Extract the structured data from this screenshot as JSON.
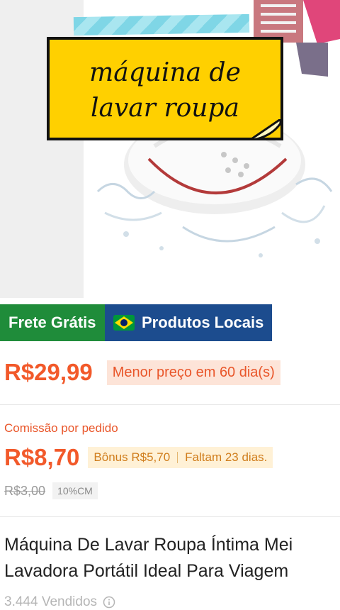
{
  "product_image": {
    "overlay_text": "máquina de lavar roupa",
    "tape_color": "#8fdbe8",
    "sticker_color": "#ffd000"
  },
  "badges": {
    "free_shipping": "Frete Grátis",
    "local_products": "Produtos Locais",
    "free_color": "#1f8c3a",
    "local_color": "#1c4c8e"
  },
  "price": {
    "current": "R$29,99",
    "lowest_badge": "Menor preço em 60 dia(s)"
  },
  "commission": {
    "label": "Comissão por pedido",
    "amount": "R$8,70",
    "bonus": "Bônus R$5,70",
    "remaining": "Faltam 23 dias.",
    "old_amount": "R$3,00",
    "rate": "10%CM"
  },
  "title": {
    "line1": "Máquina De Lavar Roupa Íntima Mei",
    "line2": "Lavadora Portátil Ideal Para Viagem"
  },
  "sold": {
    "text": "3.444 Vendidos"
  }
}
